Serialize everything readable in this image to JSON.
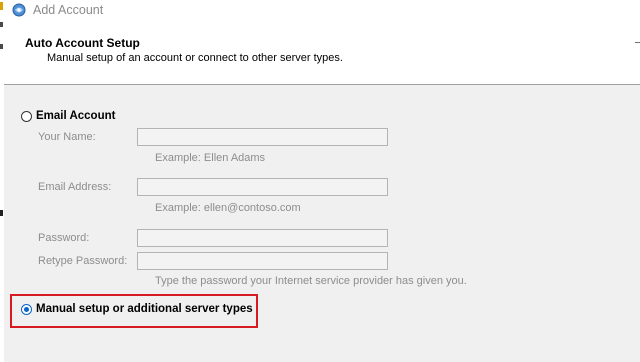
{
  "window": {
    "title": "Add Account"
  },
  "header": {
    "title": "Auto Account Setup",
    "subtitle": "Manual setup of an account or connect to other server types."
  },
  "options": {
    "email_account": {
      "label": "Email Account",
      "selected": false
    },
    "manual_setup": {
      "label": "Manual setup or additional server types",
      "selected": true
    }
  },
  "form": {
    "your_name": {
      "label": "Your Name:",
      "value": "",
      "example": "Example: Ellen Adams"
    },
    "email_address": {
      "label": "Email Address:",
      "value": "",
      "example": "Example: ellen@contoso.com"
    },
    "password": {
      "label": "Password:",
      "value": ""
    },
    "retype_password": {
      "label": "Retype Password:",
      "value": ""
    },
    "password_hint": "Type the password your Internet service provider has given you."
  },
  "colors": {
    "highlight": "#d81b22",
    "radio_selected": "#0a64c8",
    "disabled_text": "#8d8d8d"
  }
}
